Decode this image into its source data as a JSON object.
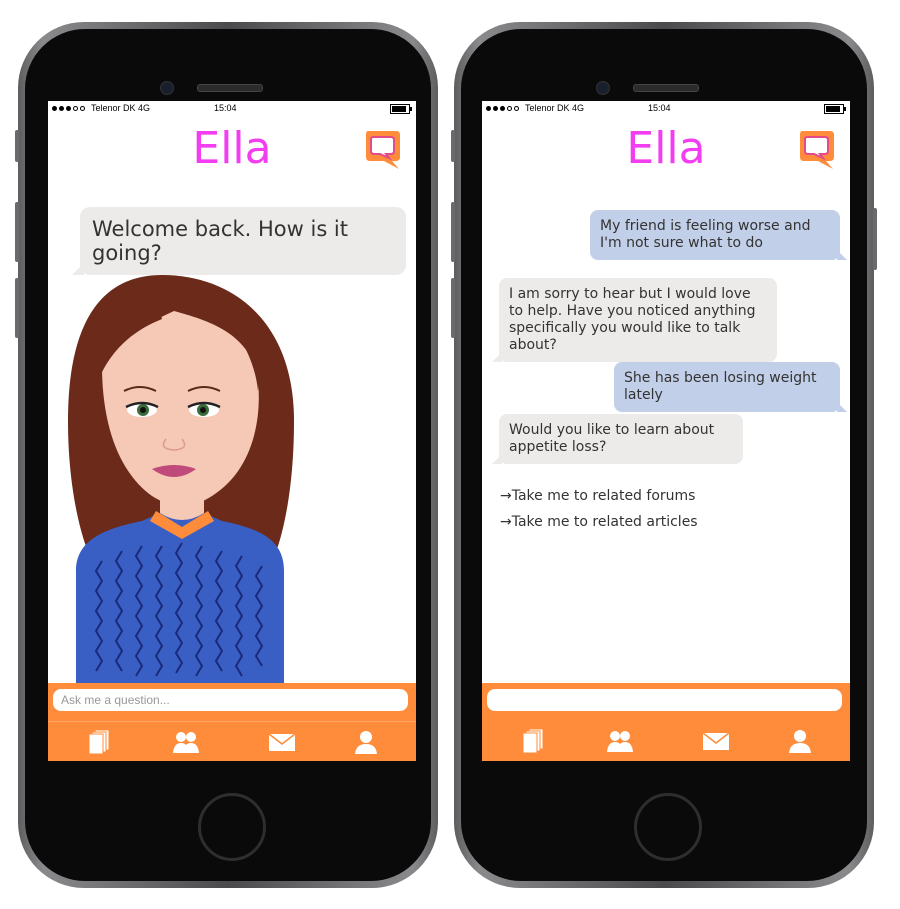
{
  "screen1": {
    "status": {
      "carrier": "Telenor DK 4G",
      "time": "15:04"
    },
    "title": "Ella",
    "greeting": "Welcome back. How is it going?",
    "input_placeholder": "Ask me a question...",
    "tabs": [
      "articles-icon",
      "community-icon",
      "messages-icon",
      "profile-icon"
    ]
  },
  "screen2": {
    "status": {
      "carrier": "Telenor DK 4G",
      "time": "15:04"
    },
    "title": "Ella",
    "messages": [
      {
        "from": "user",
        "text": "My friend is feeling worse and I'm not sure what to do"
      },
      {
        "from": "bot",
        "text": "I am sorry to hear but I would love to help. Have you noticed anything specifically you would like to talk about?"
      },
      {
        "from": "user",
        "text": "She has been losing weight lately"
      },
      {
        "from": "bot",
        "text": "Would you like to learn about appetite loss?"
      }
    ],
    "links": [
      "Take me to related forums",
      "Take me to related articles"
    ],
    "input_placeholder": "",
    "tabs": [
      "articles-icon",
      "community-icon",
      "messages-icon",
      "profile-icon"
    ]
  },
  "colors": {
    "accent": "#ff8c3a",
    "title": "#f23df0",
    "bot_bubble": "#edebe9",
    "user_bubble": "#c2cfe8"
  }
}
